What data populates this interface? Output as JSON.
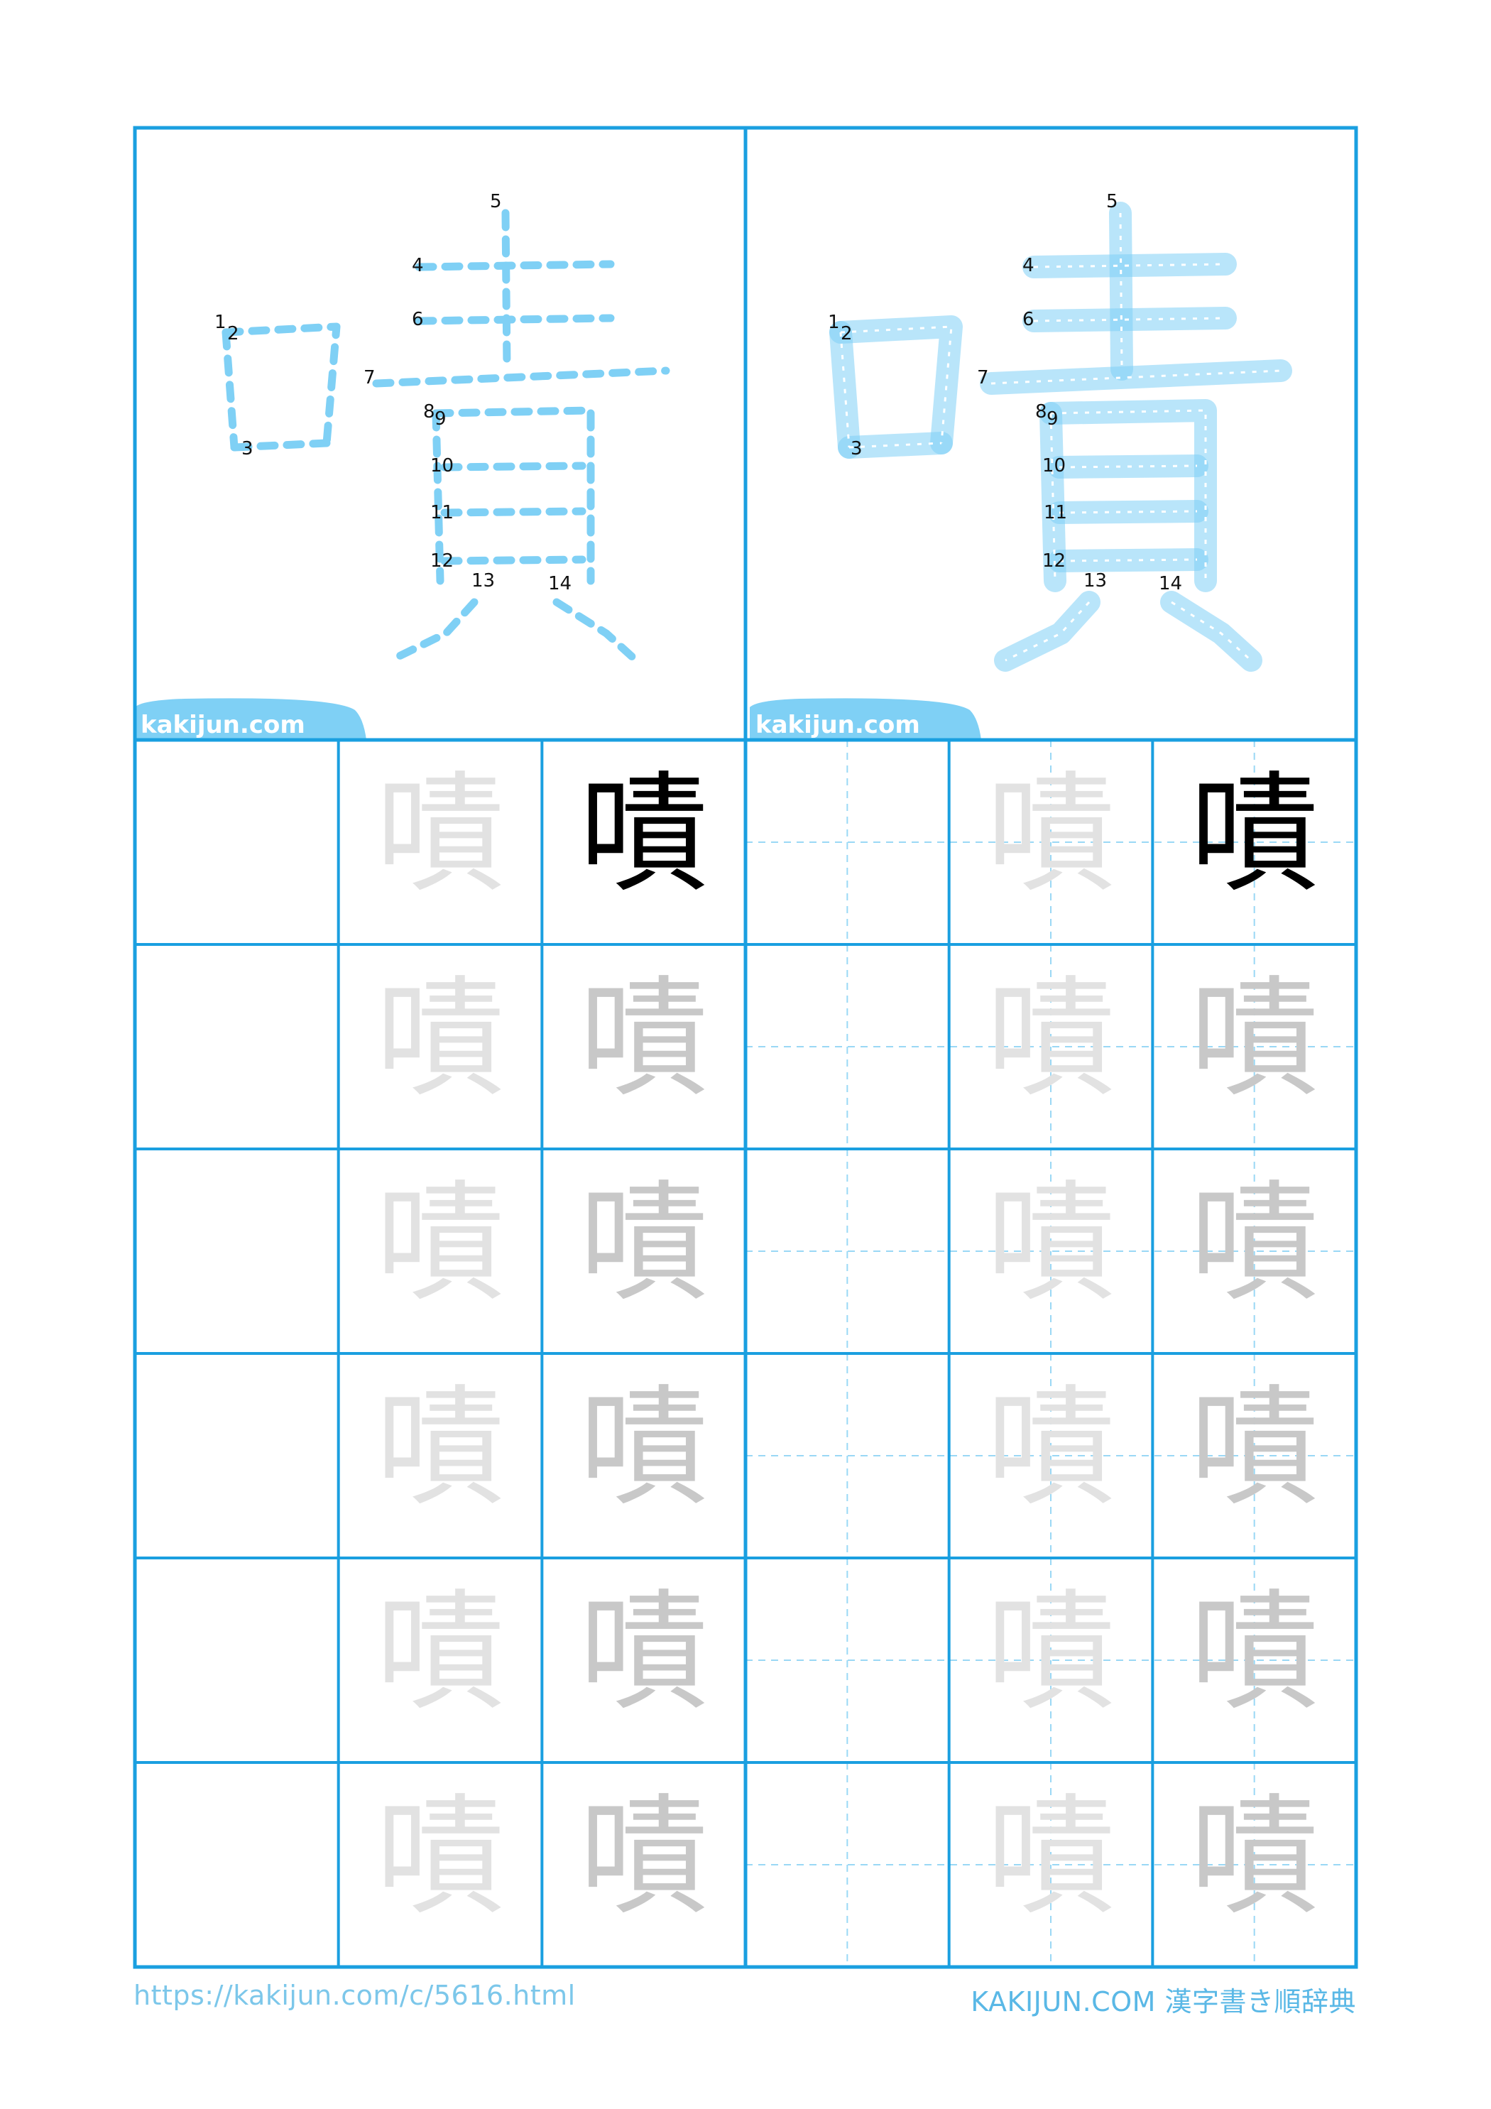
{
  "kanji": "嘖",
  "watermark": "kakijun.com",
  "stroke_numbers": [
    "1",
    "2",
    "3",
    "4",
    "5",
    "6",
    "7",
    "8",
    "9",
    "10",
    "11",
    "12",
    "13",
    "14"
  ],
  "practice": {
    "columns": [
      "empty",
      "trace",
      "trace",
      "empty",
      "trace",
      "trace"
    ],
    "rows": 6
  },
  "footer": {
    "url": "https://kakijun.com/c/5616.html",
    "brand": "KAKIJUN.COM 漢字書き順辞典"
  },
  "colors": {
    "grid": "#1a9fe0",
    "stroke_light": "#7fd0f5",
    "stroke_fill": "#b7e4fa",
    "guide": "#9ad8f5",
    "trace_dark": "#c8c8c8",
    "trace_light": "#e2e2e2",
    "model": "#000000"
  }
}
